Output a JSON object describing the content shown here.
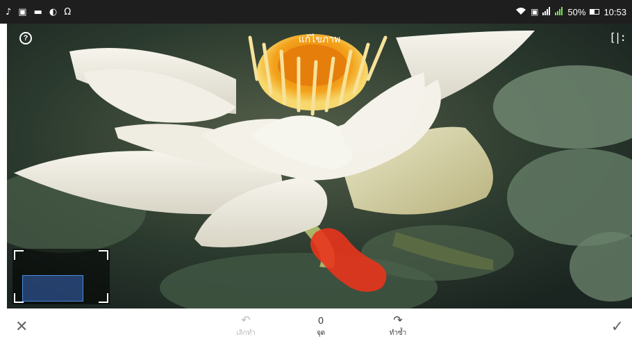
{
  "status_bar": {
    "battery": "50%",
    "time": "10:53",
    "left_icons": [
      "music-icon",
      "facebook-icon",
      "email-icon",
      "stamp-icon",
      "headset-icon"
    ],
    "right_icons": [
      "wifi-icon",
      "sim-r-icon",
      "signal-icon",
      "signal-icon-2",
      "battery-icon"
    ]
  },
  "editor": {
    "title": "แก้ไขภาพ",
    "help_glyph": "?",
    "compare_glyph": "[|:"
  },
  "toolbar": {
    "close_glyph": "✕",
    "done_glyph": "✓",
    "undo": {
      "glyph": "↶",
      "label": "เลิกทำ"
    },
    "count": {
      "value": "0",
      "label": "จุด"
    },
    "redo": {
      "glyph": "↷",
      "label": "ทำซ้ำ"
    }
  },
  "colors": {
    "status_bar": "#1e1e1e",
    "healing_mark": "#e8341c",
    "viewport_box": "#4a8ee0",
    "disabled_text": "#bbbbbb"
  }
}
